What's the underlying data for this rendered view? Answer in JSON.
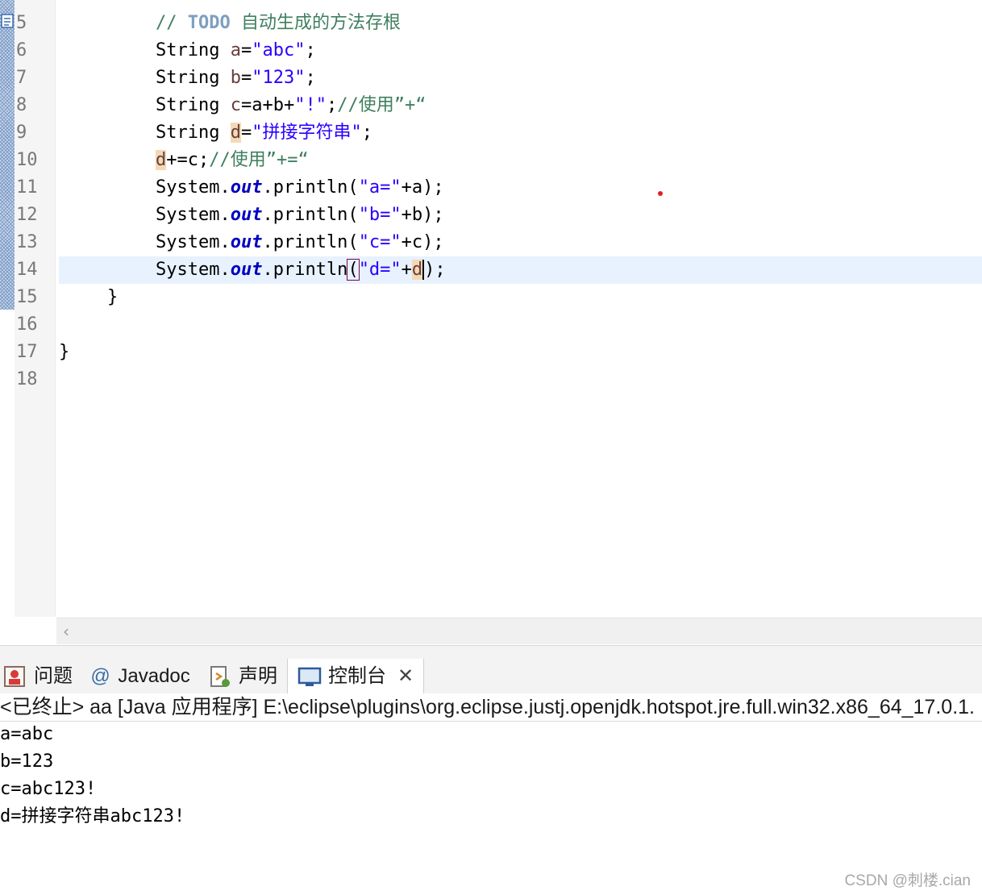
{
  "editor": {
    "line_numbers": [
      "5",
      "6",
      "7",
      "8",
      "9",
      "10",
      "11",
      "12",
      "13",
      "14",
      "15",
      "16",
      "17",
      "18"
    ],
    "lines": {
      "l5": {
        "comment_slash": "// ",
        "todo": "TODO",
        "comment_rest": " 自动生成的方法存根"
      },
      "l6": {
        "type": "String",
        "var": "a",
        "eq": "=",
        "str": "\"abc\"",
        "end": ";"
      },
      "l7": {
        "type": "String",
        "var": "b",
        "eq": "=",
        "str": "\"123\"",
        "end": ";"
      },
      "l8": {
        "type": "String",
        "var": "c",
        "expr": "=a+b+",
        "str": "\"!\"",
        "end": ";",
        "comment": "//使用”+“"
      },
      "l9": {
        "type": "String",
        "var": "d",
        "eq": "=",
        "str": "\"拼接字符串\"",
        "end": ";"
      },
      "l10": {
        "var": "d",
        "expr": "+=c;",
        "comment": "//使用”+=“"
      },
      "l11": {
        "cls": "System.",
        "field": "out",
        "call": ".println(",
        "str": "\"a=\"",
        "rest": "+a);"
      },
      "l12": {
        "cls": "System.",
        "field": "out",
        "call": ".println(",
        "str": "\"b=\"",
        "rest": "+b);"
      },
      "l13": {
        "cls": "System.",
        "field": "out",
        "call": ".println(",
        "str": "\"c=\"",
        "rest": "+c);"
      },
      "l14": {
        "cls": "System.",
        "field": "out",
        "call": ".println",
        "open": "(",
        "str": "\"d=\"",
        "plus": "+",
        "var": "d",
        "close": ")",
        "end": ";"
      },
      "l15": {
        "text": "}"
      },
      "l17": {
        "text": "}"
      }
    },
    "current_line": "14"
  },
  "tabs": [
    {
      "label": "问题",
      "icon": "problems-icon"
    },
    {
      "label": "@",
      "icon": "at-icon"
    },
    {
      "label": "Javadoc",
      "icon": "javadoc-icon"
    },
    {
      "label": "声明",
      "icon": "declaration-icon"
    },
    {
      "label": "控制台",
      "icon": "console-icon",
      "active": true
    }
  ],
  "console": {
    "header": "<已终止> aa [Java 应用程序] E:\\eclipse\\plugins\\org.eclipse.justj.openjdk.hotspot.jre.full.win32.x86_64_17.0.1.",
    "output": [
      "a=abc",
      "b=123",
      "c=abc123!",
      "d=拼接字符串abc123!"
    ]
  },
  "watermark": "CSDN @刺楼.cian",
  "colors": {
    "keyword": "#7f0055",
    "string": "#2a00ff",
    "comment": "#3f7f5f",
    "field": "#0000c0",
    "current_line": "#e8f2fe"
  }
}
